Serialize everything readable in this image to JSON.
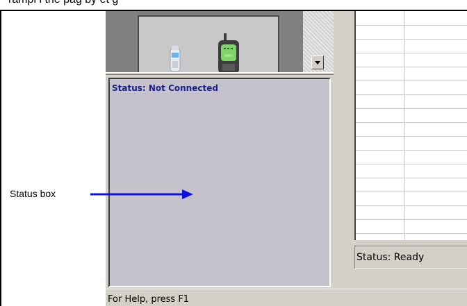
{
  "top_caption": "rampl i   the pag     by   et    g   ",
  "device_pane": {
    "small_phone_icon": "phone-small-icon",
    "large_phone_icon": "phone-large-icon"
  },
  "status_box": {
    "text": "Status: Not Connected"
  },
  "ready_field": {
    "text": "Status: Ready"
  },
  "help_bar": {
    "text": "For Help, press F1"
  },
  "callout": {
    "label": "Status box",
    "arrow_color": "#1010e0"
  },
  "colors": {
    "status_text": "#1a1f8c",
    "status_box_bg": "#c6c2cc",
    "window_bg": "#d4d0c8"
  }
}
